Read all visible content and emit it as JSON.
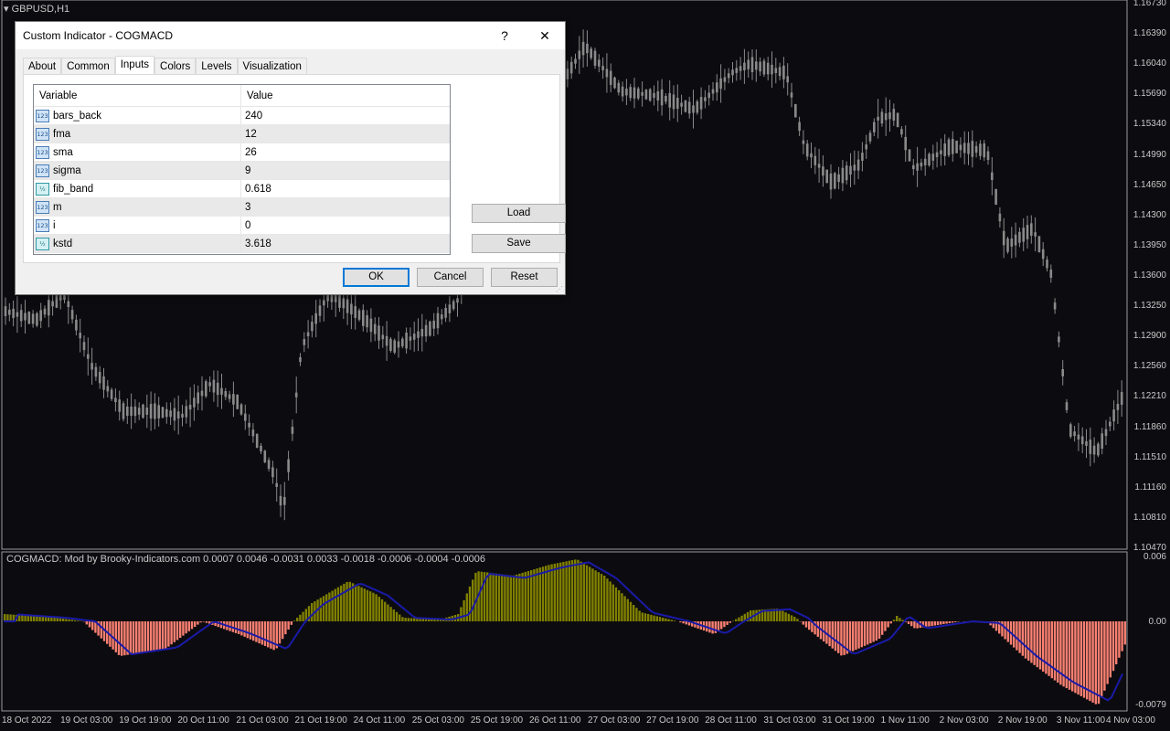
{
  "chart": {
    "symbol": "GBPUSD,H1",
    "indicator_label": "COGMACD: Mod by Brooky-Indicators.com 0.0007 0.0046 -0.0031 0.0033 -0.0018 -0.0006 -0.0004 -0.0006",
    "price_ticks": [
      "1.16730",
      "1.16390",
      "1.16040",
      "1.15690",
      "1.15340",
      "1.14990",
      "1.14650",
      "1.14300",
      "1.13950",
      "1.13600",
      "1.13250",
      "1.12900",
      "1.12560",
      "1.12210",
      "1.11860",
      "1.11510",
      "1.11160",
      "1.10810",
      "1.10470"
    ],
    "indicator_ticks": [
      "0.006",
      "0.00",
      "-0.0079"
    ],
    "time_ticks": [
      "18 Oct 2022",
      "19 Oct 03:00",
      "19 Oct 19:00",
      "20 Oct 11:00",
      "21 Oct 03:00",
      "21 Oct 19:00",
      "24 Oct 11:00",
      "25 Oct 03:00",
      "25 Oct 19:00",
      "26 Oct 11:00",
      "27 Oct 03:00",
      "27 Oct 19:00",
      "28 Oct 11:00",
      "31 Oct 03:00",
      "31 Oct 19:00",
      "1 Nov 11:00",
      "2 Nov 03:00",
      "2 Nov 19:00",
      "3 Nov 11:00",
      "4 Nov 03:00"
    ],
    "colors": {
      "background": "#0c0c10",
      "candle": "#8a8a8a",
      "hist_positive": "#808000",
      "hist_negative": "#fa8072",
      "signal_line": "#1a1aa8"
    }
  },
  "dialog": {
    "title": "Custom Indicator - COGMACD",
    "help_glyph": "?",
    "close_glyph": "✕",
    "tabs": [
      {
        "label": "About"
      },
      {
        "label": "Common"
      },
      {
        "label": "Inputs",
        "active": true
      },
      {
        "label": "Colors"
      },
      {
        "label": "Levels"
      },
      {
        "label": "Visualization"
      }
    ],
    "grid": {
      "header_variable": "Variable",
      "header_value": "Value",
      "rows": [
        {
          "icon": "int-icon",
          "icon_text": "123",
          "variable": "bars_back",
          "value": "240"
        },
        {
          "icon": "int-icon",
          "icon_text": "123",
          "variable": "fma",
          "value": "12"
        },
        {
          "icon": "int-icon",
          "icon_text": "123",
          "variable": "sma",
          "value": "26"
        },
        {
          "icon": "int-icon",
          "icon_text": "123",
          "variable": "sigma",
          "value": "9"
        },
        {
          "icon": "double-icon",
          "icon_text": "½",
          "variable": "fib_band",
          "value": "0.618"
        },
        {
          "icon": "int-icon",
          "icon_text": "123",
          "variable": "m",
          "value": "3"
        },
        {
          "icon": "int-icon",
          "icon_text": "123",
          "variable": "i",
          "value": "0"
        },
        {
          "icon": "double-icon",
          "icon_text": "½",
          "variable": "kstd",
          "value": "3.618"
        }
      ]
    },
    "load_label": "Load",
    "save_label": "Save",
    "ok_label": "OK",
    "cancel_label": "Cancel",
    "reset_label": "Reset"
  }
}
